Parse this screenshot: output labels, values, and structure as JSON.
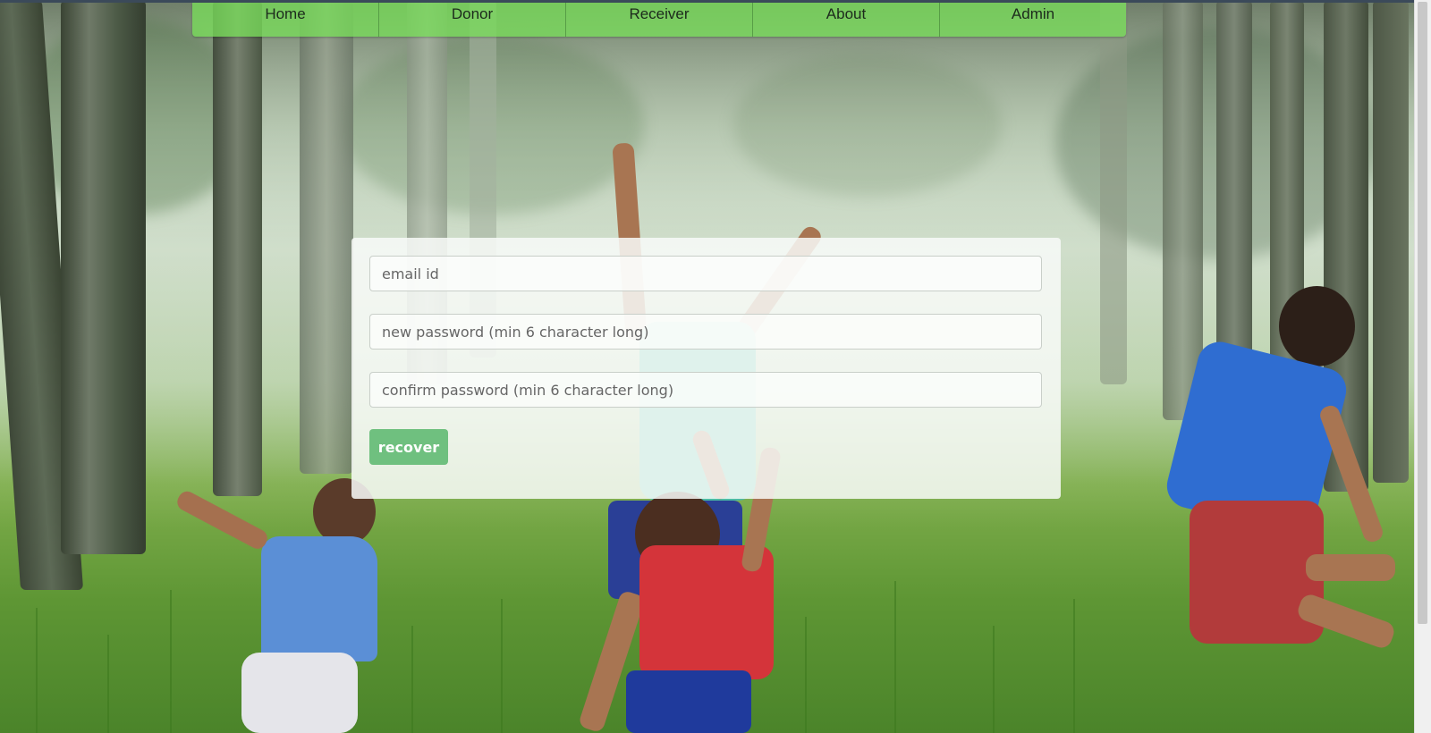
{
  "nav": {
    "items": [
      {
        "label": "Home"
      },
      {
        "label": "Donor"
      },
      {
        "label": "Receiver"
      },
      {
        "label": "About"
      },
      {
        "label": "Admin"
      }
    ]
  },
  "form": {
    "email": {
      "placeholder": "email id",
      "value": ""
    },
    "new_password": {
      "placeholder": "new password (min 6 character long)",
      "value": ""
    },
    "confirm_password": {
      "placeholder": "confirm password (min 6 character long)",
      "value": ""
    },
    "submit_label": "recover"
  },
  "colors": {
    "nav_bg": "#78dc5a",
    "button_bg": "#6fc07f"
  }
}
